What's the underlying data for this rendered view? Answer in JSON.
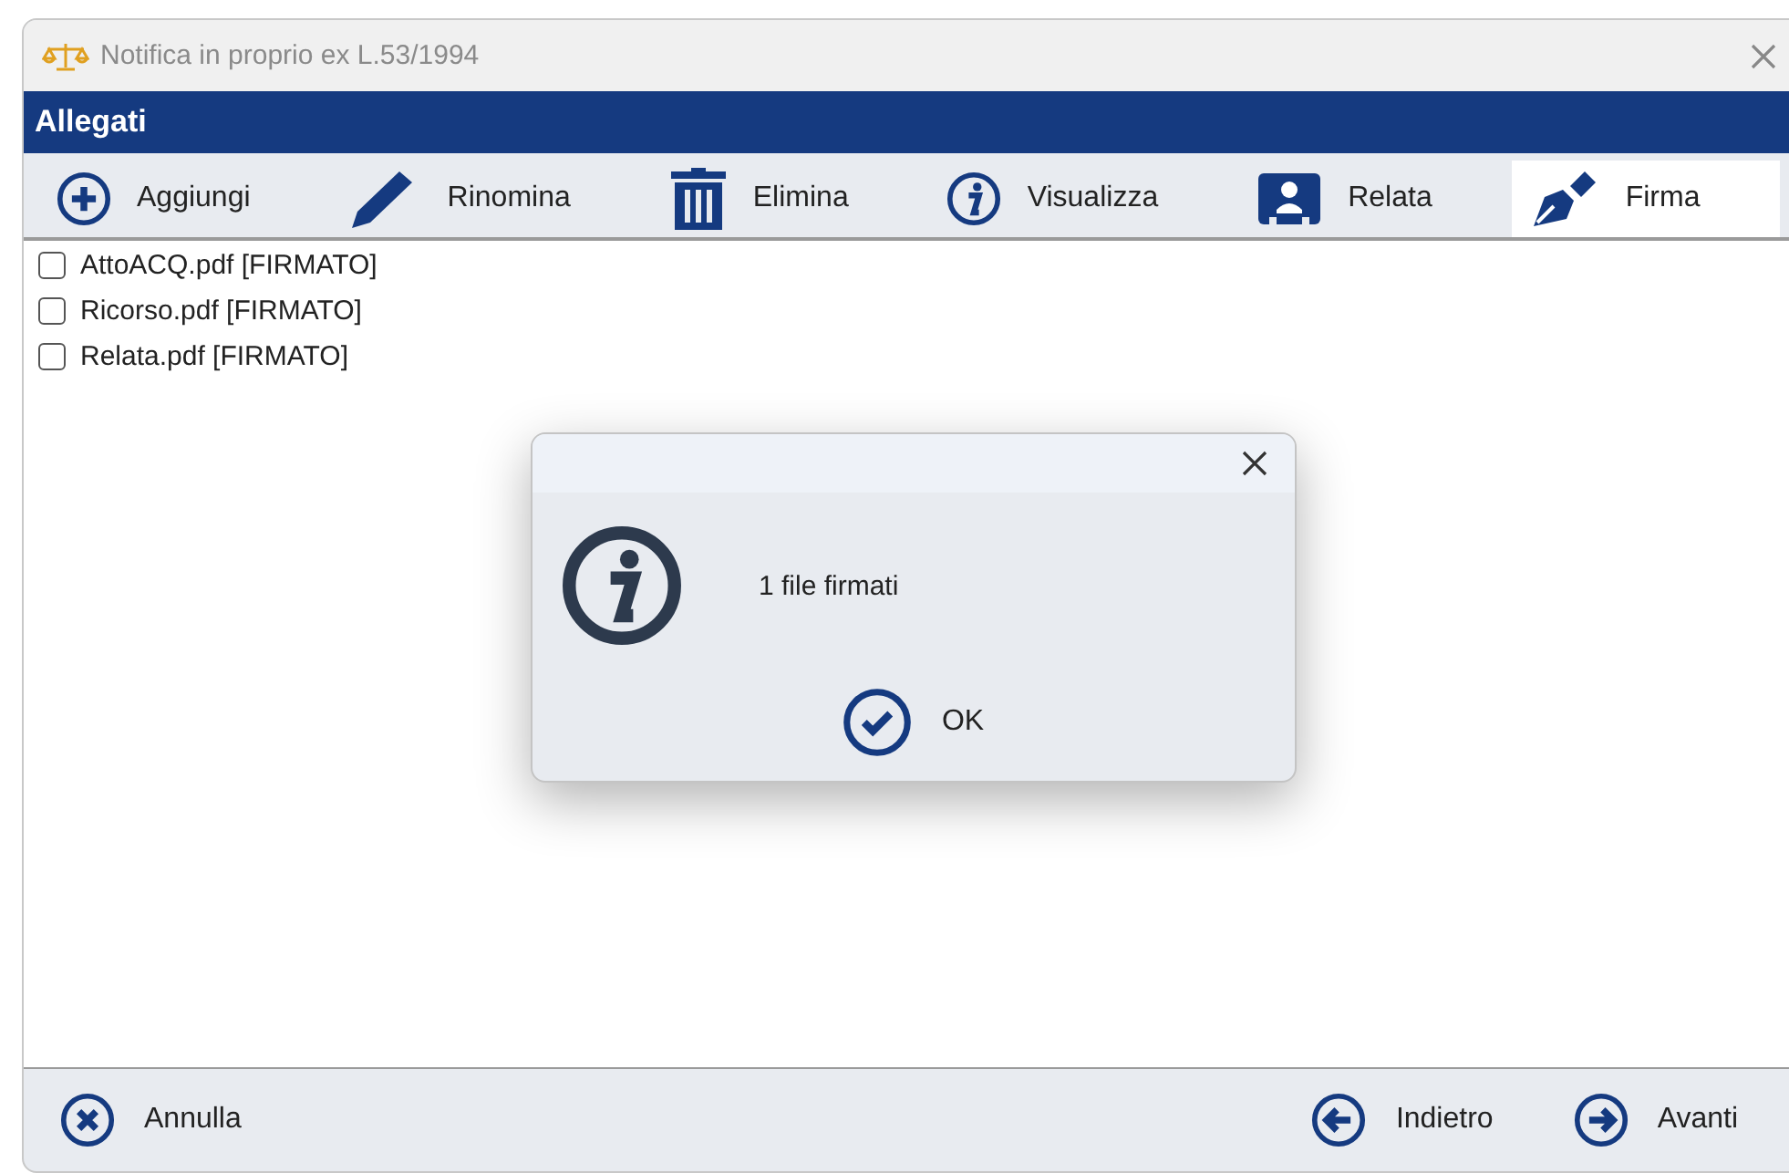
{
  "window": {
    "title": "Notifica in proprio ex L.53/1994"
  },
  "section_title": "Allegati",
  "toolbar": [
    {
      "label": "Aggiungi",
      "selected": false
    },
    {
      "label": "Rinomina",
      "selected": false
    },
    {
      "label": "Elimina",
      "selected": false
    },
    {
      "label": "Visualizza",
      "selected": false
    },
    {
      "label": "Relata",
      "selected": false
    },
    {
      "label": "Firma",
      "selected": true
    }
  ],
  "files": [
    {
      "label": "AttoACQ.pdf [FIRMATO]",
      "checked": false
    },
    {
      "label": "Ricorso.pdf [FIRMATO]",
      "checked": false
    },
    {
      "label": "Relata.pdf [FIRMATO]",
      "checked": false
    }
  ],
  "dialog": {
    "message": "1 file firmati",
    "button": "OK"
  },
  "footer_left": [
    {
      "label": "Annulla"
    }
  ],
  "footer_right": [
    {
      "label": "Indietro"
    },
    {
      "label": "Avanti"
    }
  ]
}
